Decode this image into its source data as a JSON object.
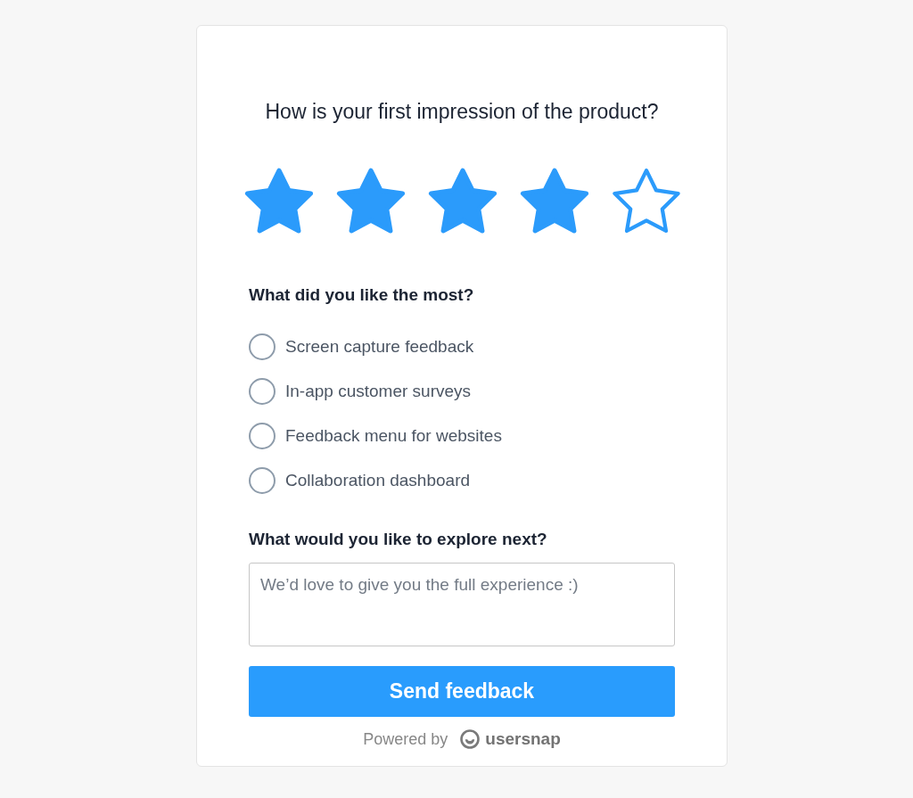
{
  "question": {
    "title": "How is your first impression of the product?"
  },
  "rating": {
    "stars": 4
  },
  "likes": {
    "label": "What did you like the most?",
    "options": [
      {
        "label": "Screen capture feedback",
        "selected": false
      },
      {
        "label": "In-app customer surveys",
        "selected": false
      },
      {
        "label": "Feedback menu for websites",
        "selected": false
      },
      {
        "label": "Collaboration dashboard",
        "selected": false
      }
    ]
  },
  "explore": {
    "label": "What would you like to explore next?",
    "placeholder": "We’d love to give you the full experience :)"
  },
  "submit_button": {
    "label": "Send feedback"
  },
  "footer": {
    "text": "Powered by",
    "brand": "usersnap"
  }
}
